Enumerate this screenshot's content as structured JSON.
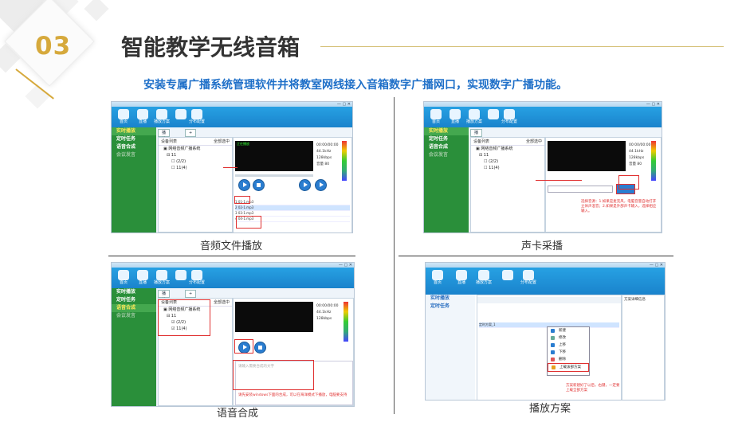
{
  "header": {
    "number": "03",
    "title": "智能教学无线音箱",
    "subtitle": "安装专属广播系统管理软件并将教室网线接入音箱数字广播网口，实现数字广播功能。"
  },
  "captions": {
    "tl": "音频文件播放",
    "tr": "声卡采播",
    "bl": "语音合成",
    "br": "播放方案"
  },
  "app": {
    "toolbar": [
      "首页",
      "直播",
      "播放方案",
      "",
      "分布配置"
    ],
    "sidebar_items": [
      "实时播放",
      "定时任务",
      "语音合成",
      "会议发言"
    ],
    "tree_header_left": "设备列表",
    "tree_header_right": "全部选中",
    "tree_root": "网络音频广播系统",
    "tree_group": "11",
    "tree_dev1": "(2/2)",
    "tree_dev2": "11(4)",
    "tab_label": "播放控制",
    "tab_plus": "+",
    "screen_status": "正在播放",
    "info_rows": [
      "00:00/00:00",
      "44.1kHz",
      "128kbps",
      "音量 80"
    ],
    "list_rows": [
      "1 01-1.mp3",
      "2 02-1.mp3",
      "3 03-1.mp3",
      "4 04-1.mp3"
    ],
    "capture_note": "选择音源：1.如果是麦克风，电脑音量自动打开立体声混音；2.如果是外部声卡输入，选择相应输入。",
    "tts_placeholder": "请输入需要合成的文字",
    "tts_note": "请先安装windows下面的合成，可以在海洋模式下播放，电脑要支持",
    "menu_items": [
      "新建",
      "修改",
      "上移",
      "下移",
      "删除",
      "上载该部方案"
    ],
    "plan_note": "方案新建好了以后，右键，一定要上载全部方案",
    "plan_side": "方案详细信息",
    "plan_row": "定时方案_1"
  }
}
